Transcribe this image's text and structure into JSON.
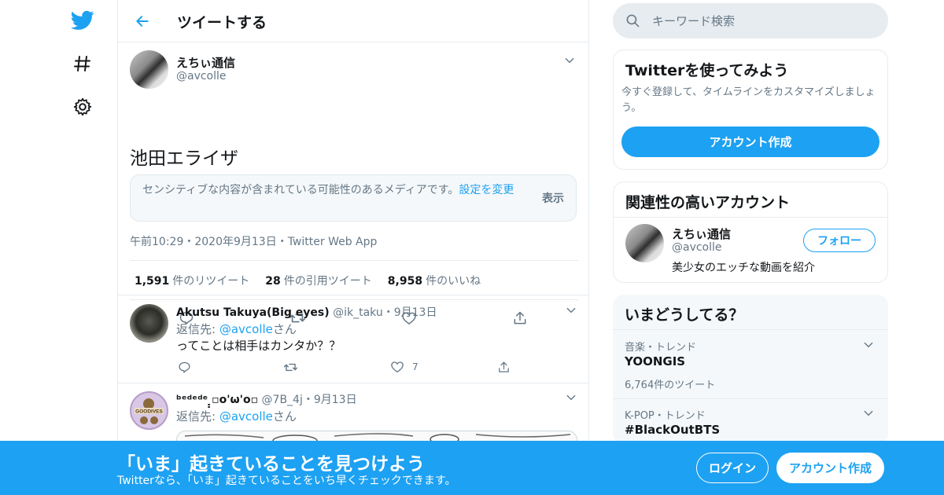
{
  "header": {
    "title": "ツイートする"
  },
  "main_tweet": {
    "name": "えちぃ通信",
    "handle": "@avcolle",
    "text": "池田エライザ",
    "sensitive_text": "センシティブな内容が含まれている可能性のあるメディアです。",
    "sensitive_link": "設定を変更",
    "show_label": "表示",
    "timestamp": "午前10:29・2020年9月13日・Twitter Web App",
    "retweets": {
      "count": "1,591",
      "label": "件のリツイート"
    },
    "quotes": {
      "count": "28",
      "label": "件の引用ツイート"
    },
    "likes": {
      "count": "8,958",
      "label": "件のいいね"
    }
  },
  "replies": [
    {
      "name": "Akutsu Takuya(Big eyes)",
      "handle": "@ik_taku",
      "date": "・9月13日",
      "reply_prefix": "返信先: ",
      "reply_to": "@avcolle",
      "reply_suffix": "さん",
      "text": "ってことは相手はカンタか？？",
      "like_count": "7"
    },
    {
      "name": "ᵇᵉᵈᵉᵈᵉ ̣̣▫o'ω'o▫",
      "handle": "@7B_4j",
      "date": "・9月13日",
      "reply_prefix": "返信先: ",
      "reply_to": "@avcolle",
      "reply_suffix": "さん",
      "avatar_text": "GOODIVES"
    }
  ],
  "search": {
    "placeholder": "キーワード検索"
  },
  "signup_card": {
    "title": "Twitterを使ってみよう",
    "description": "今すぐ登録して、タイムラインをカスタマイズしましょう。",
    "button": "アカウント作成"
  },
  "related": {
    "title": "関連性の高いアカウント",
    "name": "えちぃ通信",
    "handle": "@avcolle",
    "bio": "美少女のエッチな動画を紹介",
    "follow": "フォロー"
  },
  "trends": {
    "title": "いまどうしてる？",
    "items": [
      {
        "category": "音楽・トレンド",
        "name": "YOONGIS",
        "count": "6,764件のツイート"
      },
      {
        "category": "K-POP・トレンド",
        "name": "#BlackOutBTS"
      }
    ]
  },
  "bottom_bar": {
    "title": "「いま」起きていることを見つけよう",
    "subtitle": "Twitterなら、「いま」起きていることをいち早くチェックできます。",
    "login": "ログイン",
    "signup": "アカウント作成"
  },
  "colors": {
    "accent": "#1da1f2",
    "secondary_text": "#657786",
    "border": "#e6ecf0"
  },
  "icons": [
    "twitter-bird-icon",
    "hashtag-icon",
    "gear-icon",
    "back-arrow-icon",
    "chevron-down-icon",
    "reply-icon",
    "retweet-icon",
    "like-icon",
    "share-icon",
    "search-icon"
  ]
}
